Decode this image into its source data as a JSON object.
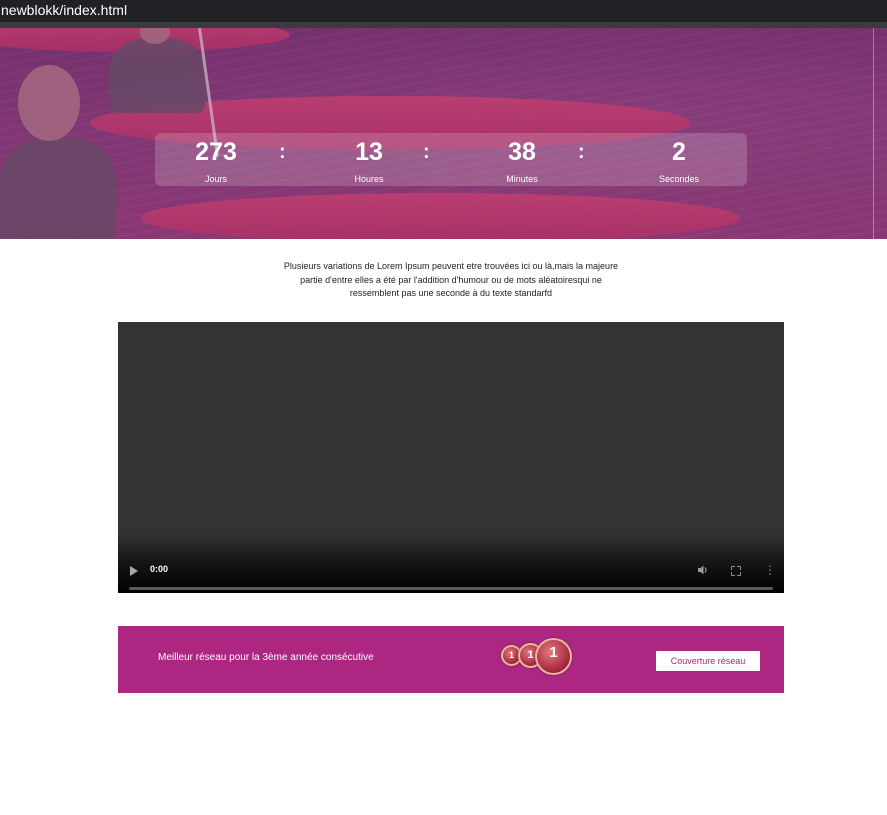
{
  "window": {
    "title": "newblokk/index.html"
  },
  "countdown": {
    "units": [
      {
        "value": "273",
        "label": "Jours"
      },
      {
        "value": "13",
        "label": "Houres"
      },
      {
        "value": "38",
        "label": "Minutes"
      },
      {
        "value": "2",
        "label": "Secondes"
      }
    ],
    "separator": ":"
  },
  "intro": {
    "text": "Plusieurs variations de Lorem Ipsum peuvent etre trouvées ici ou là,mais la majeure partie d'entre elles a été par l'addition d'humour ou de mots aléatoiresqui ne ressemblent pas une seconde à du texte standarfd"
  },
  "video": {
    "current_time": "0:00",
    "progress_fraction": 0,
    "icons": [
      "play-icon",
      "volume-icon",
      "fullscreen-icon",
      "more-options-icon"
    ]
  },
  "banner": {
    "text": "Meilleur réseau pour la 3ème année consécutive",
    "badges": [
      "1",
      "1",
      "1"
    ],
    "button_label": "Couverture réseau",
    "background_color": "#ac2682"
  }
}
